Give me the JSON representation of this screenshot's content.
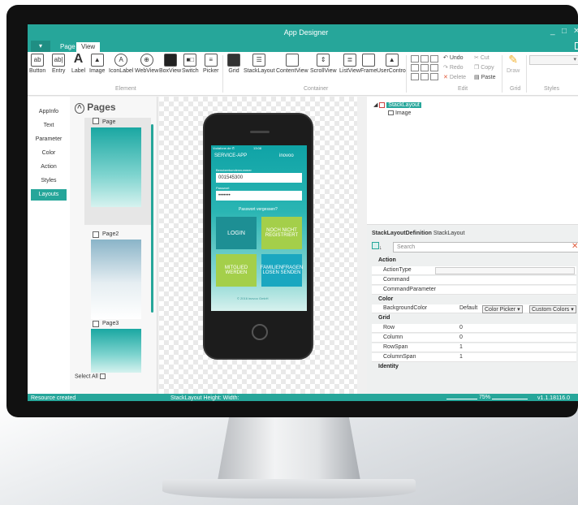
{
  "window": {
    "title": "App Designer",
    "min": "_",
    "max": "□",
    "close": "✕"
  },
  "tabs": {
    "file": "▾",
    "page": "Page",
    "view": "View"
  },
  "ribbon": {
    "element_buttons": [
      "Button",
      "Entry",
      "Label",
      "Image",
      "IconLabel",
      "WebView",
      "BoxView",
      "Switch",
      "Picker"
    ],
    "container_buttons": [
      "Grid",
      "StackLayout",
      "ContentView",
      "ScrollView",
      "ListView",
      "Frame",
      "UserControl"
    ],
    "edit": {
      "undo": "Undo",
      "redo": "Redo",
      "delete": "Delete",
      "cut": "Cut",
      "copy": "Copy",
      "paste": "Paste"
    },
    "grid_draw": "Draw",
    "groups": {
      "element": "Element",
      "container": "Container",
      "edit": "Edit",
      "grid": "Grid",
      "styles": "Styles"
    }
  },
  "leftnav": [
    "AppInfo",
    "Text",
    "Parameter",
    "Color",
    "Action",
    "Styles",
    "Layouts"
  ],
  "pages": {
    "title": "Pages",
    "items": [
      "Page",
      "Page2",
      "Page3"
    ],
    "select_all": "Select All"
  },
  "phone": {
    "status_left": "Vodafone.de ✆",
    "status_time": "13:08",
    "app_name": "SERVICE-APP",
    "brand": "inovoo",
    "label_customer": "Benutzerkundennummer",
    "customer_value": "001545300",
    "label_password": "Passwort",
    "password_value": "•••••••",
    "forgot": "Passwort vergessen?",
    "tile_login": "LOGIN",
    "tile_register": "NOCH NICHT REGISTRIERT",
    "tile_member": "MITGLIED WERDEN",
    "tile_faq": "FAMILIENFRAGEN LOSEN SENDEN",
    "footer": "© 2016 inovoo GmbH"
  },
  "tree": {
    "root": "StackLayout",
    "child": "Image"
  },
  "props": {
    "header_type": "StackLayoutDefinition",
    "header_name": "StackLayout",
    "search_placeholder": "Search",
    "cat_action": "Action",
    "action_type": "ActionType",
    "command": "Command",
    "command_param": "CommandParameter",
    "cat_color": "Color",
    "bg_color": "BackgroundColor",
    "bg_value": "Default",
    "color_picker": "Color Picker",
    "custom_colors": "Custom Colors",
    "cat_grid": "Grid",
    "row": "Row",
    "row_v": "0",
    "column": "Column",
    "column_v": "0",
    "rowspan": "RowSpan",
    "rowspan_v": "1",
    "colspan": "ColumnSpan",
    "colspan_v": "1",
    "cat_identity": "Identity"
  },
  "status": {
    "left": "Resource created",
    "mid": "StackLayout  Height:  Width:",
    "zoom": "75%",
    "version": "v1.1.18116.0"
  },
  "colors": {
    "accent": "#26a69a"
  }
}
